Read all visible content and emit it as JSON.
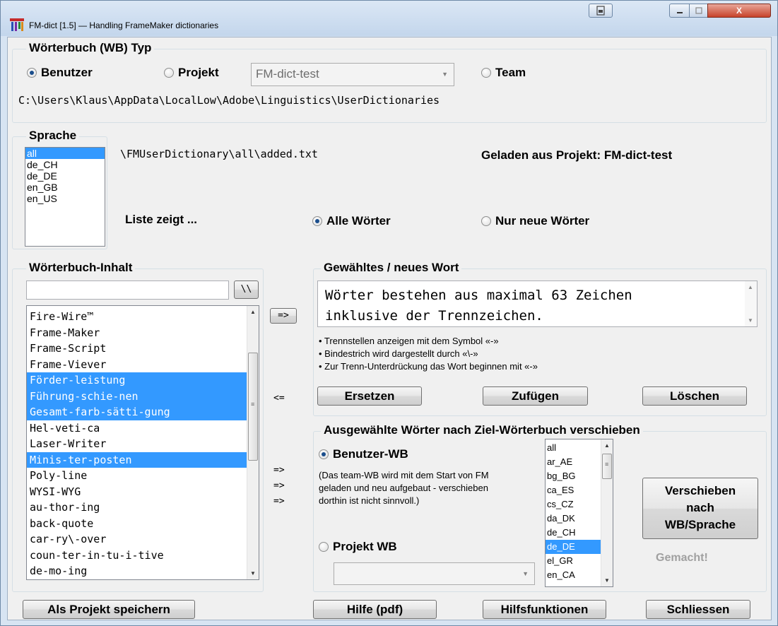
{
  "window": {
    "title": "FM-dict [1.5] — Handling FrameMaker dictionaries",
    "close_label": "X"
  },
  "wb_type": {
    "group_label": "Wörterbuch (WB) Typ",
    "radio_user": "Benutzer",
    "radio_project": "Projekt",
    "project_combo_value": "FM-dict-test",
    "radio_team": "Team",
    "selected": "Benutzer",
    "path": "C:\\Users\\Klaus\\AppData\\LocalLow\\Adobe\\Linguistics\\UserDictionaries"
  },
  "sprache": {
    "group_label": "Sprache",
    "items": [
      "all",
      "de_CH",
      "de_DE",
      "en_GB",
      "en_US"
    ],
    "selected": "all",
    "file_path": "\\FMUserDictionary\\all\\added.txt",
    "loaded_from": "Geladen aus Projekt: FM-dict-test",
    "list_shows_label": "Liste zeigt ...",
    "radio_all": "Alle Wörter",
    "radio_new": "Nur neue Wörter"
  },
  "content": {
    "group_label": "Wörterbuch-Inhalt",
    "filter_value": "",
    "filter_button": "\\\\",
    "words": [
      {
        "text": "Fire-Wire™",
        "selected": false
      },
      {
        "text": "Frame-Maker",
        "selected": false
      },
      {
        "text": "Frame-Script",
        "selected": false
      },
      {
        "text": "Frame-Viever",
        "selected": false
      },
      {
        "text": "Förder-leistung",
        "selected": true
      },
      {
        "text": "Führung-schie-nen",
        "selected": true
      },
      {
        "text": "Gesamt-farb-sätti-gung",
        "selected": true
      },
      {
        "text": "Hel-veti-ca",
        "selected": false
      },
      {
        "text": "Laser-Writer",
        "selected": false
      },
      {
        "text": "Minis-ter-posten",
        "selected": true
      },
      {
        "text": "Poly-line",
        "selected": false
      },
      {
        "text": "WYSI-WYG",
        "selected": false
      },
      {
        "text": "au-thor-ing",
        "selected": false
      },
      {
        "text": "back-quote",
        "selected": false
      },
      {
        "text": "car-ry\\-over",
        "selected": false
      },
      {
        "text": "coun-ter-in-tu-i-tive",
        "selected": false
      },
      {
        "text": "de-mo-ing",
        "selected": false
      }
    ]
  },
  "arrows": {
    "to_word": "=>",
    "from_word": "<=",
    "move1": "=>",
    "move2": "=>",
    "move3": "=>"
  },
  "word": {
    "group_label": "Gewähltes / neues Wort",
    "text_line1": "Wörter bestehen aus maximal 63 Zeichen",
    "text_line2": "inklusive der Trennzeichen.",
    "hints": [
      "• Trennstellen anzeigen mit dem Symbol «-»",
      "• Bindestrich wird dargestellt durch «\\-»",
      "• Zur Trenn-Unterdrückung das Wort beginnen mit «-»"
    ],
    "btn_replace": "Ersetzen",
    "btn_add": "Zufügen",
    "btn_delete": "Löschen"
  },
  "move": {
    "group_label": "Ausgewählte Wörter nach Ziel-Wörterbuch verschieben",
    "radio_user_wb": "Benutzer-WB",
    "note_line1": "(Das team-WB wird mit dem Start von FM",
    "note_line2": "geladen und neu aufgebaut - verschieben",
    "note_line3": "dorthin ist nicht sinnvoll.)",
    "radio_project_wb": "Projekt WB",
    "project_combo_value": "",
    "languages": [
      "all",
      "ar_AE",
      "bg_BG",
      "ca_ES",
      "cs_CZ",
      "da_DK",
      "de_CH",
      "de_DE",
      "el_GR",
      "en_CA"
    ],
    "selected_language": "de_DE",
    "btn_move_line1": "Verschieben",
    "btn_move_line2": "nach",
    "btn_move_line3": "WB/Sprache",
    "status": "Gemacht!"
  },
  "footer": {
    "btn_save_project": "Als Projekt speichern",
    "btn_help": "Hilfe (pdf)",
    "btn_functions": "Hilfsfunktionen",
    "btn_close": "Schliessen"
  },
  "colors": {
    "selection": "#3399ff",
    "disabled_text": "#a0a0a0"
  }
}
